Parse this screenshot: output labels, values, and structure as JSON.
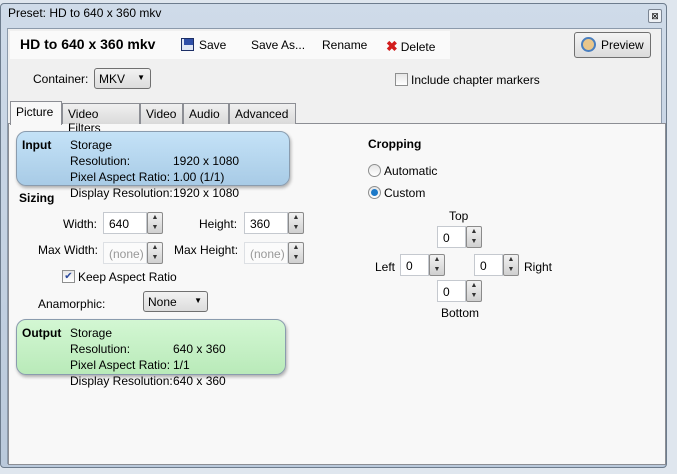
{
  "window": {
    "title": "Preset: HD to 640 x 360 mkv",
    "close_label": "⊠"
  },
  "toolbar": {
    "preset_name": "HD to 640 x 360 mkv",
    "save": "Save",
    "save_as": "Save As...",
    "rename": "Rename",
    "delete": "Delete",
    "preview": "Preview"
  },
  "container": {
    "label": "Container:",
    "value": "MKV",
    "chapter_markers_label": "Include chapter markers",
    "chapter_markers_checked": false
  },
  "tabs": [
    {
      "label": "Picture",
      "active": true
    },
    {
      "label": "Video Filters"
    },
    {
      "label": "Video"
    },
    {
      "label": "Audio"
    },
    {
      "label": "Advanced"
    }
  ],
  "input": {
    "title": "Input",
    "storage_label": "Storage Resolution:",
    "storage": "1920 x 1080",
    "par_label": "Pixel Aspect Ratio:",
    "par": "1.00 (1/1)",
    "display_label": "Display Resolution:",
    "display": "1920 x 1080",
    "color": "#bcdcf3"
  },
  "sizing": {
    "title": "Sizing",
    "width_label": "Width:",
    "width": "640",
    "height_label": "Height:",
    "height": "360",
    "max_width_label": "Max Width:",
    "max_width": "(none)",
    "max_height_label": "Max Height:",
    "max_height": "(none)",
    "keep_aspect_label": "Keep Aspect Ratio",
    "keep_aspect_checked": true,
    "anamorphic_label": "Anamorphic:",
    "anamorphic": "None"
  },
  "output": {
    "title": "Output",
    "storage_label": "Storage Resolution:",
    "storage": "640 x 360",
    "par_label": "Pixel Aspect Ratio:",
    "par": "1/1",
    "display_label": "Display Resolution:",
    "display": "640 x 360",
    "color": "#c8f2c8"
  },
  "cropping": {
    "title": "Cropping",
    "automatic": "Automatic",
    "custom": "Custom",
    "selected": "Custom",
    "top_label": "Top",
    "top": "0",
    "left_label": "Left",
    "left": "0",
    "right_label": "Right",
    "right": "0",
    "bottom_label": "Bottom",
    "bottom": "0"
  }
}
